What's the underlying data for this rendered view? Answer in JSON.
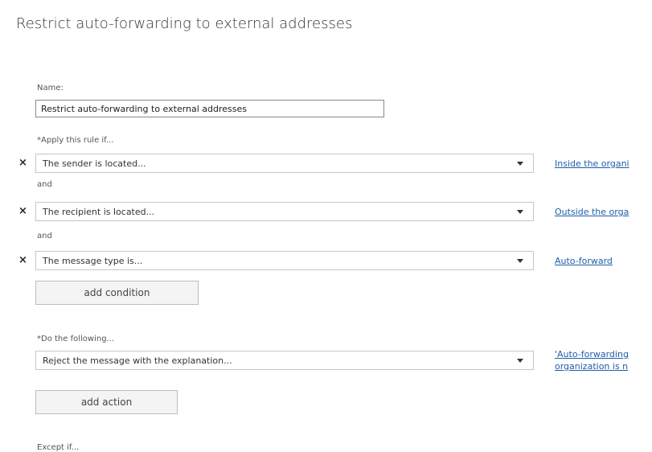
{
  "page": {
    "title": "Restrict auto-forwarding to external addresses"
  },
  "name_field": {
    "label": "Name:",
    "value": "Restrict auto-forwarding to external addresses"
  },
  "conditions": {
    "label": "*Apply this rule if...",
    "and_label": "and",
    "items": [
      {
        "remove_icon": "×",
        "value": "The sender is located...",
        "link": "Inside the organi"
      },
      {
        "remove_icon": "×",
        "value": "The recipient is located...",
        "link": "Outside the orga"
      },
      {
        "remove_icon": "×",
        "value": "The message type is...",
        "link": "Auto-forward"
      }
    ],
    "add_button": "add condition"
  },
  "actions": {
    "label": "*Do the following...",
    "items": [
      {
        "value": "Reject the message with the explanation...",
        "link_line1": "'Auto-forwarding",
        "link_line2": "organization is n"
      }
    ],
    "add_button": "add action"
  },
  "exceptions": {
    "label": "Except if..."
  },
  "icons": {
    "remove": "close-icon",
    "dropdown": "chevron-down-icon"
  },
  "colors": {
    "link": "#1f5ea8",
    "button_bg": "#f4f4f4",
    "border": "#c6c6c6"
  }
}
